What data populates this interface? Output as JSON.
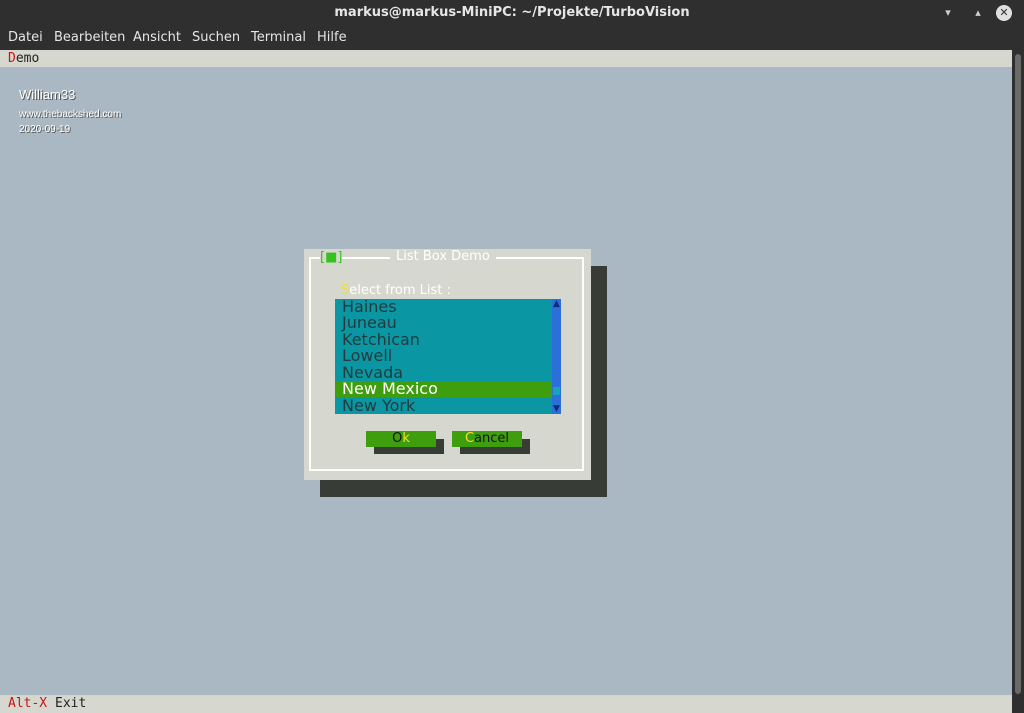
{
  "window": {
    "title": "markus@markus-MiniPC: ~/Projekte/TurboVision"
  },
  "menubar": [
    "Datei",
    "Bearbeiten",
    "Ansicht",
    "Suchen",
    "Terminal",
    "Hilfe"
  ],
  "tv": {
    "menu": {
      "hot": "D",
      "rest": "emo"
    },
    "info": {
      "name": "William33",
      "site": "www.thebackshed.com",
      "date": "2020-09-19"
    },
    "status": {
      "key": "Alt-X",
      "label": "Exit"
    }
  },
  "dialog": {
    "title": "List Box Demo",
    "close_glyph": "[■]",
    "list_label": {
      "hot": "S",
      "rest": "elect from List :"
    },
    "items": [
      "Haines",
      "Juneau",
      "Ketchican",
      "Lowell",
      "Nevada",
      "New Mexico",
      "New York"
    ],
    "selected_index": 5,
    "ok": {
      "pre": "O",
      "hot": "k",
      "post": ""
    },
    "cancel": {
      "pre": "",
      "hot": "C",
      "post": "ancel"
    }
  }
}
